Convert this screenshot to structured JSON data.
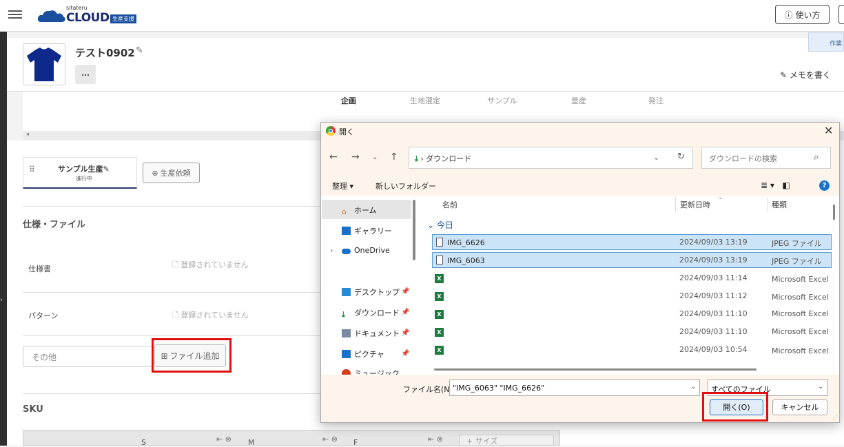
{
  "app": {
    "logo_small": "sitateru",
    "logo_main": "CLOUD",
    "logo_badge": "生産支援",
    "help_label": "使い方",
    "side_tab": "作業"
  },
  "project": {
    "title": "テスト0902",
    "more": "…",
    "memo_label": "メモを書く"
  },
  "phases": [
    "企画",
    "生地選定",
    "サンプル",
    "量産",
    "発注"
  ],
  "tabs": {
    "sample_label": "サンプル生産",
    "sample_status": "進行中",
    "add_production": "生産依頼"
  },
  "spec": {
    "section_title": "仕様・ファイル",
    "rows": [
      {
        "label": "仕様書",
        "status": "登録されていません"
      },
      {
        "label": "パターン",
        "status": "登録されていません"
      }
    ],
    "other_placeholder": "その他",
    "file_add_label": "ファイル追加"
  },
  "sku": {
    "section_title": "SKU",
    "cols": [
      "S",
      "M",
      "F"
    ],
    "add_size": "+ サイズ"
  },
  "dialog": {
    "title": "開く",
    "address_path": "ダウンロード",
    "search_placeholder": "ダウンロードの検索",
    "organize": "整理 ▾",
    "new_folder": "新しいフォルダー",
    "nav": [
      {
        "label": "ホーム",
        "pin": false
      },
      {
        "label": "ギャラリー",
        "pin": false
      },
      {
        "label": "OneDrive",
        "pin": false
      },
      {
        "label": "デスクトップ",
        "pin": true
      },
      {
        "label": "ダウンロード",
        "pin": true
      },
      {
        "label": "ドキュメント",
        "pin": true
      },
      {
        "label": "ピクチャ",
        "pin": true
      },
      {
        "label": "ミュージック",
        "pin": false
      }
    ],
    "columns": {
      "name": "名前",
      "date": "更新日時",
      "type": "種類"
    },
    "group": "今日",
    "files": [
      {
        "name": "IMG_6626",
        "date": "2024/09/03 13:19",
        "type": "JPEG ファイル",
        "kind": "img",
        "selected": true
      },
      {
        "name": "IMG_6063",
        "date": "2024/09/03 13:19",
        "type": "JPEG ファイル",
        "kind": "img",
        "selected": true
      },
      {
        "name": "",
        "date": "2024/09/03 11:14",
        "type": "Microsoft Excel ワ",
        "kind": "xl",
        "selected": false
      },
      {
        "name": "",
        "date": "2024/09/03 11:12",
        "type": "Microsoft Excel ワ",
        "kind": "xl",
        "selected": false
      },
      {
        "name": "",
        "date": "2024/09/03 11:10",
        "type": "Microsoft Excel C",
        "kind": "xl",
        "selected": false
      },
      {
        "name": "",
        "date": "2024/09/03 11:10",
        "type": "Microsoft Excel C",
        "kind": "xl",
        "selected": false
      },
      {
        "name": "",
        "date": "2024/09/03 10:54",
        "type": "Microsoft Excel ワ",
        "kind": "xl",
        "selected": false
      }
    ],
    "filename_label": "ファイル名(N):",
    "filename_value": "\"IMG_6063\" \"IMG_6626\"",
    "filetype_value": "すべてのファイル",
    "open_label": "開く(O)",
    "cancel_label": "キャンセル"
  }
}
